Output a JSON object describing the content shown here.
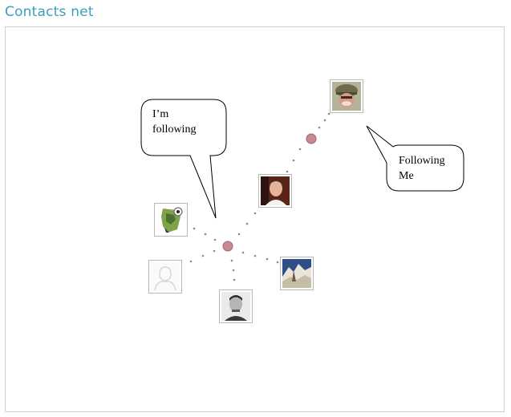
{
  "header": {
    "title": "Contacts net"
  },
  "callouts": {
    "following": {
      "line1": "I’m",
      "line2": "following"
    },
    "followers": {
      "line1": "Following",
      "line2": "Me"
    }
  },
  "contacts": [
    {
      "id": "soldier",
      "icon": "soldier-avatar-icon"
    },
    {
      "id": "man-red",
      "icon": "man-portrait-avatar-icon"
    },
    {
      "id": "cartoon",
      "icon": "cartoon-creature-avatar-icon"
    },
    {
      "id": "placeholder",
      "icon": "default-silhouette-avatar-icon"
    },
    {
      "id": "landscape",
      "icon": "landscape-avatar-icon"
    },
    {
      "id": "man-gray",
      "icon": "grayscale-man-avatar-icon"
    }
  ],
  "colors": {
    "title": "#3aa0b9",
    "node": "#c48a8f",
    "dots": "#8a8a8a",
    "border": "#cfcfcf"
  }
}
